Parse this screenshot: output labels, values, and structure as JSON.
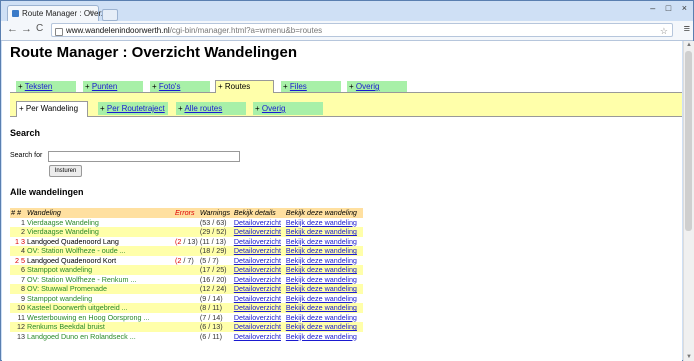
{
  "browser": {
    "tab_title": "Route Manager : Overzicht",
    "tab_close": "×",
    "url_domain": "www.wandelenindoorwerth.nl",
    "url_path": "/cgi-bin/manager.html?a=wmenu&b=routes",
    "back": "←",
    "forward": "→",
    "reload": "C",
    "star": "☆",
    "menu": "≡",
    "win_min": "–",
    "win_max": "□",
    "win_close": "×"
  },
  "page": {
    "title": "Route Manager : Overzicht Wandelingen"
  },
  "main_tabs": [
    {
      "label": "Teksten",
      "prefix": "+ ",
      "active": false
    },
    {
      "label": "Punten",
      "prefix": "+ ",
      "active": false
    },
    {
      "label": "Foto's",
      "prefix": "+ ",
      "active": false
    },
    {
      "label": "Routes",
      "prefix": "+ ",
      "active": true
    },
    {
      "label": "Files",
      "prefix": "+ ",
      "active": false
    },
    {
      "label": "Overig",
      "prefix": "+ ",
      "active": false
    }
  ],
  "sub_tabs": [
    {
      "label": "Per Wandeling",
      "prefix": "+ ",
      "active": true
    },
    {
      "label": "Per Routetraject",
      "prefix": "+ ",
      "active": false
    },
    {
      "label": "Alle routes",
      "prefix": "+ ",
      "active": false
    },
    {
      "label": "Overig",
      "prefix": "+ ",
      "active": false
    }
  ],
  "search": {
    "heading": "Search",
    "label": "Search for",
    "value": "",
    "button": "Insturen"
  },
  "list": {
    "heading": "Alle wandelingen",
    "headers": {
      "num": "# #",
      "name": "Wandeling",
      "errors": "Errors",
      "warnings": "Warnings",
      "details": "Bekijk details",
      "view": "Bekijk deze wandeling"
    },
    "rows": [
      {
        "num": "1",
        "name": "Vierdaagse Wandeling",
        "errors": "",
        "warnings": "(53 / 63)",
        "details": "Detailoverzicht",
        "view": "Bekijk deze wandeling",
        "name_color": "green",
        "num_red": false
      },
      {
        "num": "2",
        "name": "Vierdaagse Wandeling",
        "errors": "",
        "warnings": "(29 / 52)",
        "details": "Detailoverzicht",
        "view": "Bekijk deze wandeling",
        "name_color": "green",
        "num_red": false
      },
      {
        "num": "1 3",
        "name": "Landgoed Quadenoord Lang",
        "errors_a": "2",
        "errors_b": "13",
        "warnings": "(11 / 13)",
        "details": "Detailoverzicht",
        "view": "Bekijk deze wandeling",
        "name_color": "black",
        "num_red": true
      },
      {
        "num": "4",
        "name": "OV: Station Wolfheze - oude ...",
        "errors": "",
        "warnings": "(18 / 29)",
        "details": "Detailoverzicht",
        "view": "Bekijk deze wandeling",
        "name_color": "green",
        "num_red": false
      },
      {
        "num": "2 5",
        "name": "Landgoed Quadenoord Kort",
        "errors_a": "2",
        "errors_b": "7",
        "warnings": "(5 / 7)",
        "details": "Detailoverzicht",
        "view": "Bekijk deze wandeling",
        "name_color": "black",
        "num_red": true
      },
      {
        "num": "6",
        "name": "Stamppot wandeling",
        "errors": "",
        "warnings": "(17 / 25)",
        "details": "Detailoverzicht",
        "view": "Bekijk deze wandeling",
        "name_color": "green",
        "num_red": false
      },
      {
        "num": "7",
        "name": "OV: Station Wolfheze - Renkum ...",
        "errors": "",
        "warnings": "(16 / 20)",
        "details": "Detailoverzicht",
        "view": "Bekijk deze wandeling",
        "name_color": "green",
        "num_red": false
      },
      {
        "num": "8",
        "name": "OV: Stuwwal Promenade",
        "errors": "",
        "warnings": "(12 / 24)",
        "details": "Detailoverzicht",
        "view": "Bekijk deze wandeling",
        "name_color": "green",
        "num_red": false
      },
      {
        "num": "9",
        "name": "Stamppot wandeling",
        "errors": "",
        "warnings": "(9 / 14)",
        "details": "Detailoverzicht",
        "view": "Bekijk deze wandeling",
        "name_color": "green",
        "num_red": false
      },
      {
        "num": "10",
        "name": "Kasteel Doorwerth uitgebreid ...",
        "errors": "",
        "warnings": "(8 / 11)",
        "details": "Detailoverzicht",
        "view": "Bekijk deze wandeling",
        "name_color": "green",
        "num_red": false
      },
      {
        "num": "11",
        "name": "Westerbouwing en Hoog Oorsprong ...",
        "errors": "",
        "warnings": "(7 / 14)",
        "details": "Detailoverzicht",
        "view": "Bekijk deze wandeling",
        "name_color": "green",
        "num_red": false
      },
      {
        "num": "12",
        "name": "Renkums Beekdal bruist",
        "errors": "",
        "warnings": "(6 / 13)",
        "details": "Detailoverzicht",
        "view": "Bekijk deze wandeling",
        "name_color": "green",
        "num_red": false
      },
      {
        "num": "13",
        "name": "Landgoed Duno en Rolandseck ...",
        "errors": "",
        "warnings": "(6 / 11)",
        "details": "Detailoverzicht",
        "view": "Bekijk deze wandeling",
        "name_color": "green",
        "num_red": false
      }
    ]
  }
}
